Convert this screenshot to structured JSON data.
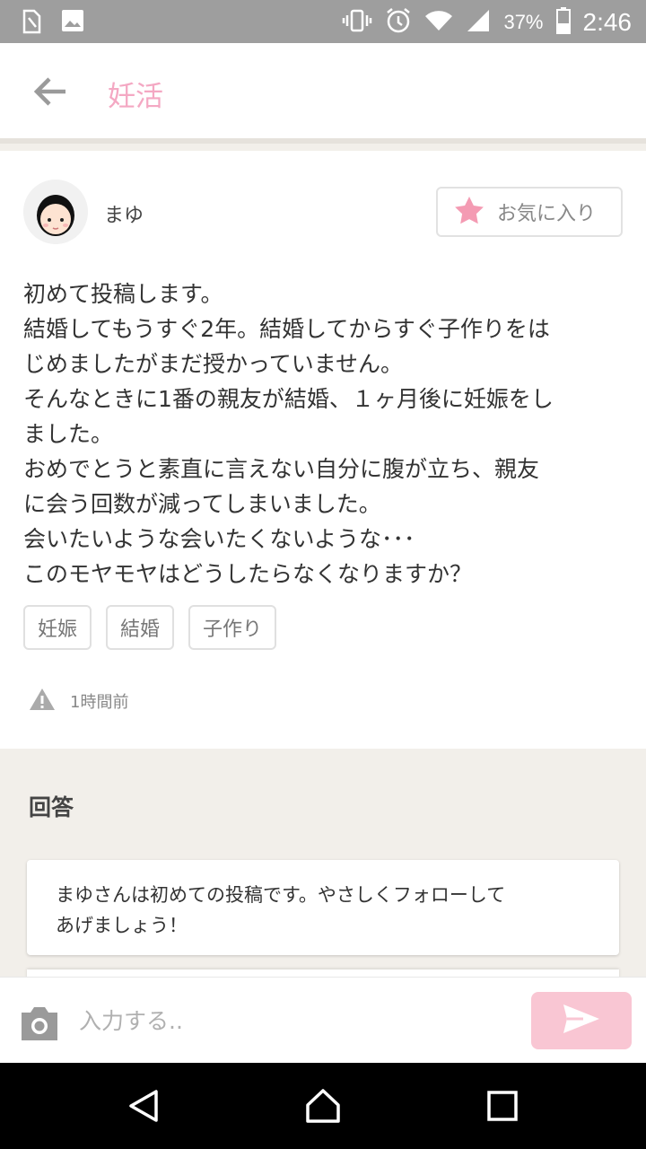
{
  "status_bar": {
    "battery": "37%",
    "time": "2:46",
    "icons": [
      "sim-card-icon",
      "image-icon",
      "vibrate-icon",
      "alarm-icon",
      "wifi-icon",
      "signal-icon",
      "battery-icon"
    ]
  },
  "app_bar": {
    "title": "妊活",
    "back_icon": "arrow-left-icon"
  },
  "post": {
    "author": "まゆ",
    "favorite_label": "お気に入り",
    "body_lines": [
      "初めて投稿します。",
      "結婚してもうすぐ2年。結婚してからすぐ子作りをは",
      "じめましたがまだ授かっていません。",
      "そんなときに1番の親友が結婚、１ヶ月後に妊娠をし",
      "ました。",
      "おめでとうと素直に言えない自分に腹が立ち、親友",
      "に会う回数が減ってしまいました。",
      "会いたいような会いたくないような･･･",
      "このモヤモヤはどうしたらなくなりますか？"
    ],
    "tags": [
      "妊娠",
      "結婚",
      "子作り"
    ],
    "time_ago": "1時間前"
  },
  "answers": {
    "heading": "回答",
    "notice_lines": [
      "まゆさんは初めての投稿です。やさしくフォローして",
      "あげましょう！"
    ]
  },
  "composer": {
    "placeholder": "入力する..",
    "value": ""
  },
  "colors": {
    "accent_pink": "#f4a8c3",
    "send_button": "#f9c6d3",
    "star": "#f49bb3",
    "status_bar": "#9e9e9e"
  }
}
